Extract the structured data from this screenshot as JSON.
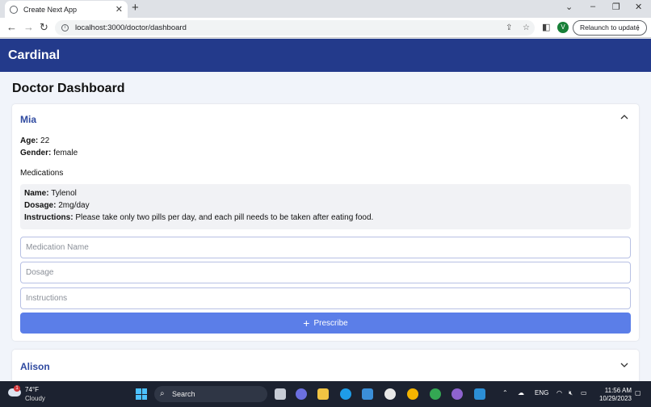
{
  "browser": {
    "tab_title": "Create Next App",
    "url": "localhost:3000/doctor/dashboard",
    "relaunch_label": "Relaunch to update",
    "profile_initial": "V"
  },
  "app": {
    "brand": "Cardinal",
    "page_title": "Doctor Dashboard"
  },
  "patients": [
    {
      "name": "Mia",
      "expanded": true,
      "age_label": "Age:",
      "age": "22",
      "gender_label": "Gender:",
      "gender": "female",
      "medications_heading": "Medications",
      "medications": [
        {
          "name_label": "Name:",
          "name": "Tylenol",
          "dosage_label": "Dosage:",
          "dosage": "2mg/day",
          "instructions_label": "Instructions:",
          "instructions": "Please take only two pills per day, and each pill needs to be taken after eating food."
        }
      ],
      "form": {
        "medication_name_placeholder": "Medication Name",
        "dosage_placeholder": "Dosage",
        "instructions_placeholder": "Instructions",
        "prescribe_label": "Prescribe"
      }
    },
    {
      "name": "Alison",
      "expanded": false
    }
  ],
  "taskbar": {
    "temperature": "74°F",
    "condition": "Cloudy",
    "notification_count": "1",
    "search_label": "Search",
    "language": "ENG",
    "time": "11:56 AM",
    "date": "10/29/2023"
  },
  "colors": {
    "appbar": "#233a8b",
    "accent": "#2f4aa0",
    "prescribe_button": "#5b7ee8",
    "page_background": "#f1f4fa"
  }
}
